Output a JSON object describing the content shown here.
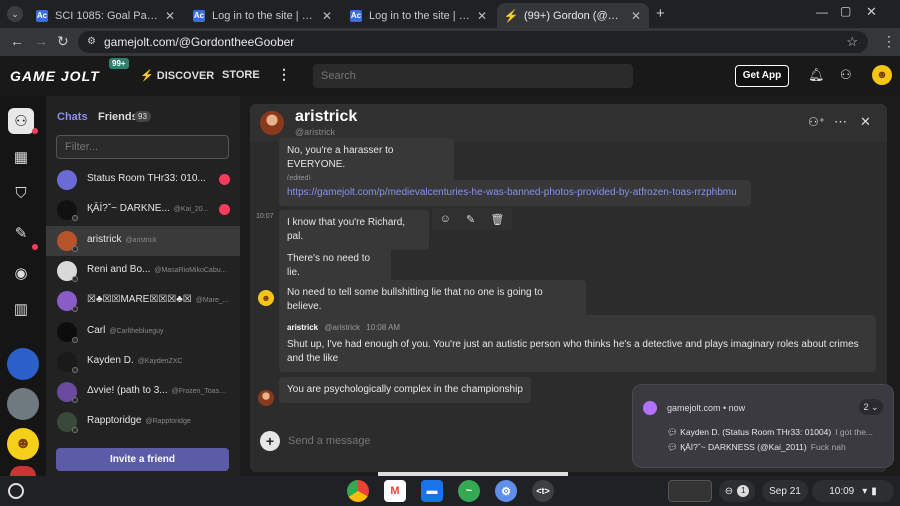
{
  "tabs": [
    {
      "title": "SCI 1085: Goal Page | aceconn",
      "favicon": "ac"
    },
    {
      "title": "Log in to the site | aceconnect",
      "favicon": "ac"
    },
    {
      "title": "Log in to the site | aceconnect",
      "favicon": "ac"
    },
    {
      "title": "(99+) Gordon (@GordontheeGo",
      "favicon": "gj",
      "active": true
    }
  ],
  "address_bar": {
    "url": "gamejolt.com/@GordontheeGoober"
  },
  "site": {
    "logo_text": "GAME JOLT",
    "logo_badge": "99+",
    "nav_discover": "DISCOVER",
    "nav_store": "STORE",
    "search_placeholder": "Search",
    "get_app": "Get App"
  },
  "chat_list": {
    "tab_chats": "Chats",
    "tab_friends": "Friends",
    "friends_count": "93",
    "filter_placeholder": "Filter...",
    "items": [
      {
        "name": "Status Room THr33: 010...",
        "user": "",
        "unread": true,
        "avatar_color": "#6b6bd6"
      },
      {
        "name": "ҚĀİ?ˇ~ DARKNE...",
        "user": "@Kai_20...",
        "unread": true,
        "avatar_color": "#111111"
      },
      {
        "name": "aristrick",
        "user": "@aristrick",
        "unread": false,
        "avatar_color": "#b5542a",
        "selected": true
      },
      {
        "name": "Reni and Bo...",
        "user": "@MasaRioMikoCabu...",
        "unread": false,
        "avatar_color": "#d9d9d9"
      },
      {
        "name": "☒♣☒☒MARE☒☒☒♣☒",
        "user": "@Mare_...",
        "unread": false,
        "avatar_color": "#8a5cc7"
      },
      {
        "name": "Carl",
        "user": "@Carltheblueguy",
        "unread": false,
        "avatar_color": "#0d0d0d"
      },
      {
        "name": "Kayden D.",
        "user": "@KaydenZXC",
        "unread": false,
        "avatar_color": "#1a1a1a"
      },
      {
        "name": "Δvvie! (path to 3...",
        "user": "@Frozen_Toas...",
        "unread": false,
        "avatar_color": "#6a4aa0"
      },
      {
        "name": "Rapptoridge",
        "user": "@Rapptoridge",
        "unread": false,
        "avatar_color": "#3a4a3a"
      }
    ],
    "invite_label": "Invite a friend"
  },
  "chat": {
    "name": "aristrick",
    "username": "@aristrick",
    "messages": {
      "m1": "No, you're a harasser to EVERYONE.",
      "m1_edited": "(edited)",
      "m2_link": "https://gamejolt.com/p/medievalcenturies-he-was-banned-photos-provided-by-atfrozen-toas-rrzphbmu",
      "m3_time": "10:07",
      "m3": "I know that you're Richard, pal.",
      "m4": "There's no need to lie.",
      "m5": "No need to tell some bullshitting lie that no one is going to believe.",
      "m6_author": "aristrick",
      "m6_user": "@aristrick",
      "m6_time": "10:08 AM",
      "m6": "Shut up,  I've had enough of you. You're just an autistic person who thinks he's a detective and plays imaginary roles about crimes and the like",
      "m7": "You are psychologically complex in the championship"
    },
    "composer_placeholder": "Send a message"
  },
  "notification": {
    "source": "gamejolt.com • now",
    "count": "2",
    "lines": [
      {
        "title": "Kayden D. (Status Room THr33: 01004)",
        "preview": "I got the..."
      },
      {
        "title": "ҚĀİ?ˇ~ DARKNESS (@Kai_2011)",
        "preview": "Fuck nah"
      }
    ]
  },
  "shelf": {
    "date": "Sep 21",
    "time": "10:09",
    "notif_count": "1"
  },
  "colors": {
    "accent": "#5b5ba8",
    "unread": "#ff3b5c",
    "link": "#8e8ef5"
  }
}
